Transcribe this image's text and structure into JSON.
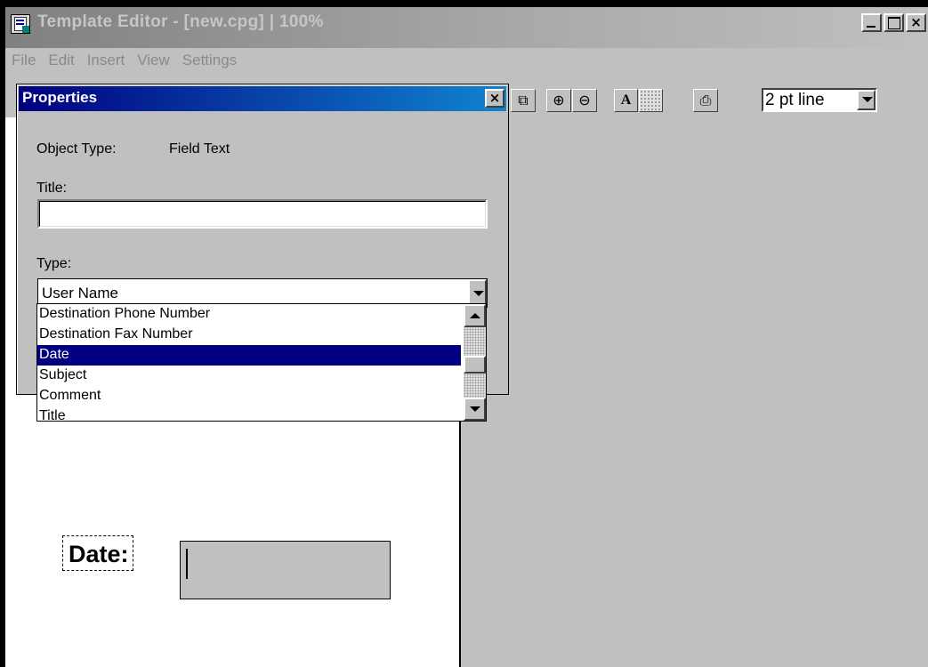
{
  "window": {
    "title": "Template Editor - [new.cpg] | 100%",
    "close_glyph": "×"
  },
  "menu": {
    "items": [
      "File",
      "Edit",
      "Insert",
      "View",
      "Settings"
    ]
  },
  "toolbar": {
    "line_width_value": "2 pt line",
    "buttons": [
      {
        "name": "copy-object-button",
        "icon": "overlap-squares-icon",
        "glyph": "⧉"
      },
      {
        "name": "zoom-in-button",
        "icon": "zoom-in-icon",
        "glyph": "⊕"
      },
      {
        "name": "zoom-out-button",
        "icon": "zoom-out-icon",
        "glyph": "⊖"
      },
      {
        "name": "font-button",
        "icon": "font-a-icon",
        "glyph": "A"
      },
      {
        "name": "fill-pattern-button",
        "icon": "dotted-fill-icon",
        "glyph": ""
      },
      {
        "name": "print-button",
        "icon": "printer-icon",
        "glyph": "⎙"
      }
    ]
  },
  "properties": {
    "title": "Properties",
    "close_glyph": "×",
    "object_type_label": "Object Type:",
    "object_type_value": "Field Text",
    "title_label": "Title:",
    "title_value": "",
    "type_label": "Type:",
    "type_value": "User Name",
    "dropdown_options": [
      "Destination Phone Number",
      "Destination Fax Number",
      "Date",
      "Subject",
      "Comment",
      "Title"
    ],
    "selected_option": "Date"
  },
  "canvas": {
    "date_label": "Date:"
  },
  "colors": {
    "selection": "#000080",
    "face": "#c0c0c0",
    "titlebar_active": "#000080"
  }
}
